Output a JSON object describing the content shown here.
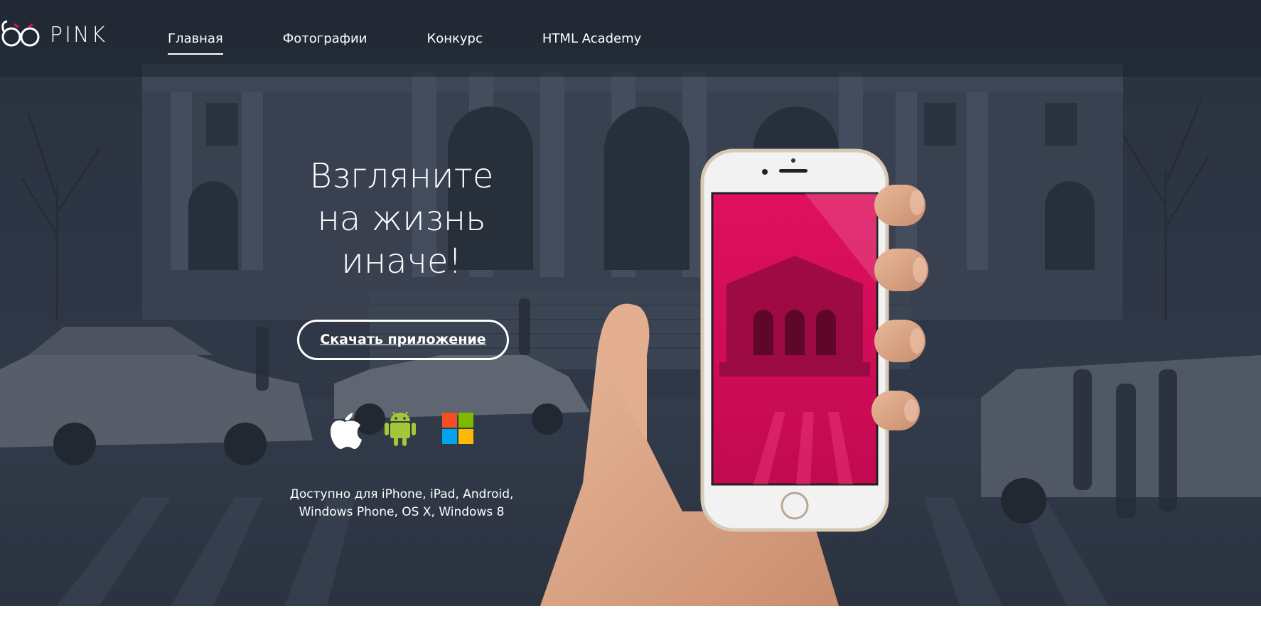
{
  "brand": {
    "name": "PINK"
  },
  "nav": {
    "items": [
      {
        "label": "Главная",
        "active": true
      },
      {
        "label": "Фотографии",
        "active": false
      },
      {
        "label": "Конкурс",
        "active": false
      },
      {
        "label": "HTML Academy",
        "active": false
      }
    ]
  },
  "hero": {
    "headline_line1": "Взгляните",
    "headline_line2": "на жизнь",
    "headline_line3": "иначе!",
    "cta_label": "Скачать приложение",
    "platform_icons": [
      "apple-icon",
      "android-icon",
      "windows-icon"
    ],
    "availability_line1": "Доступно для iPhone, iPad, Android,",
    "availability_line2": "Windows Phone, OS X, Windows 8"
  },
  "colors": {
    "accent_pink": "#e0105e",
    "android_green": "#a4c639",
    "windows_red": "#f25022",
    "windows_green": "#7fba00",
    "windows_blue": "#00a4ef",
    "windows_yellow": "#ffb900"
  }
}
